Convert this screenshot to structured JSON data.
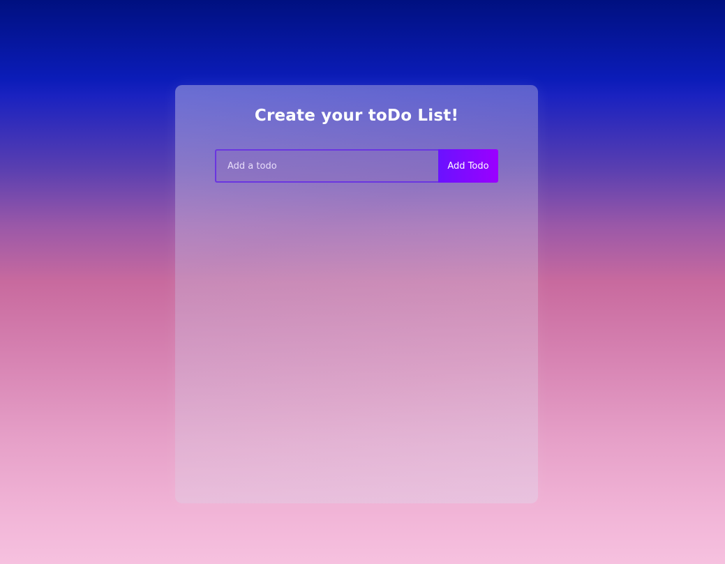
{
  "card": {
    "title": "Create your toDo List!"
  },
  "form": {
    "input_value": "",
    "input_placeholder": "Add a todo",
    "add_button_label": "Add Todo"
  },
  "todos": [],
  "colors": {
    "accent_border": "#6a35e0",
    "button_gradient_start": "#6a12ff",
    "button_gradient_end": "#9b00ff",
    "background_top": "#001080",
    "background_bottom": "#f6c1df"
  }
}
